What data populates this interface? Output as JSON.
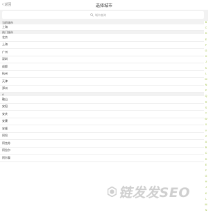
{
  "header": {
    "back_label": "返回",
    "title": "选择城市"
  },
  "search": {
    "placeholder": "城市查询"
  },
  "list": [
    {
      "type": "header",
      "label": "当前城市"
    },
    {
      "type": "city",
      "label": "上海"
    },
    {
      "type": "header",
      "label": "热门城市"
    },
    {
      "type": "city",
      "label": "北京"
    },
    {
      "type": "city",
      "label": "上海"
    },
    {
      "type": "city",
      "label": "广州"
    },
    {
      "type": "city",
      "label": "深圳"
    },
    {
      "type": "city",
      "label": "成都"
    },
    {
      "type": "city",
      "label": "杭州"
    },
    {
      "type": "city",
      "label": "天津"
    },
    {
      "type": "city",
      "label": "郑州"
    },
    {
      "type": "header",
      "label": "A"
    },
    {
      "type": "city",
      "label": "鞍山"
    },
    {
      "type": "city",
      "label": "安阳"
    },
    {
      "type": "city",
      "label": "安庆"
    },
    {
      "type": "city",
      "label": "安康"
    },
    {
      "type": "city",
      "label": "安顺"
    },
    {
      "type": "city",
      "label": "阿坝"
    },
    {
      "type": "city",
      "label": "阿克苏"
    },
    {
      "type": "city",
      "label": "阿拉尔"
    },
    {
      "type": "city",
      "label": "阿尔泰"
    }
  ],
  "index_letters": [
    "B",
    "C",
    "D",
    "E",
    "F",
    "G",
    "H",
    "J",
    "K",
    "L",
    "M",
    "N",
    "P",
    "Q",
    "R",
    "S",
    "T",
    "W",
    "X",
    "Y",
    "Z",
    "A",
    "B",
    "C",
    "D",
    "E",
    "F",
    "G",
    "H",
    "J",
    "K",
    "L",
    "M",
    "N"
  ],
  "watermark": {
    "text": "链发发SEO"
  },
  "colors": {
    "accent": "#9bbd3a",
    "header_bg": "#f2f2f2"
  }
}
